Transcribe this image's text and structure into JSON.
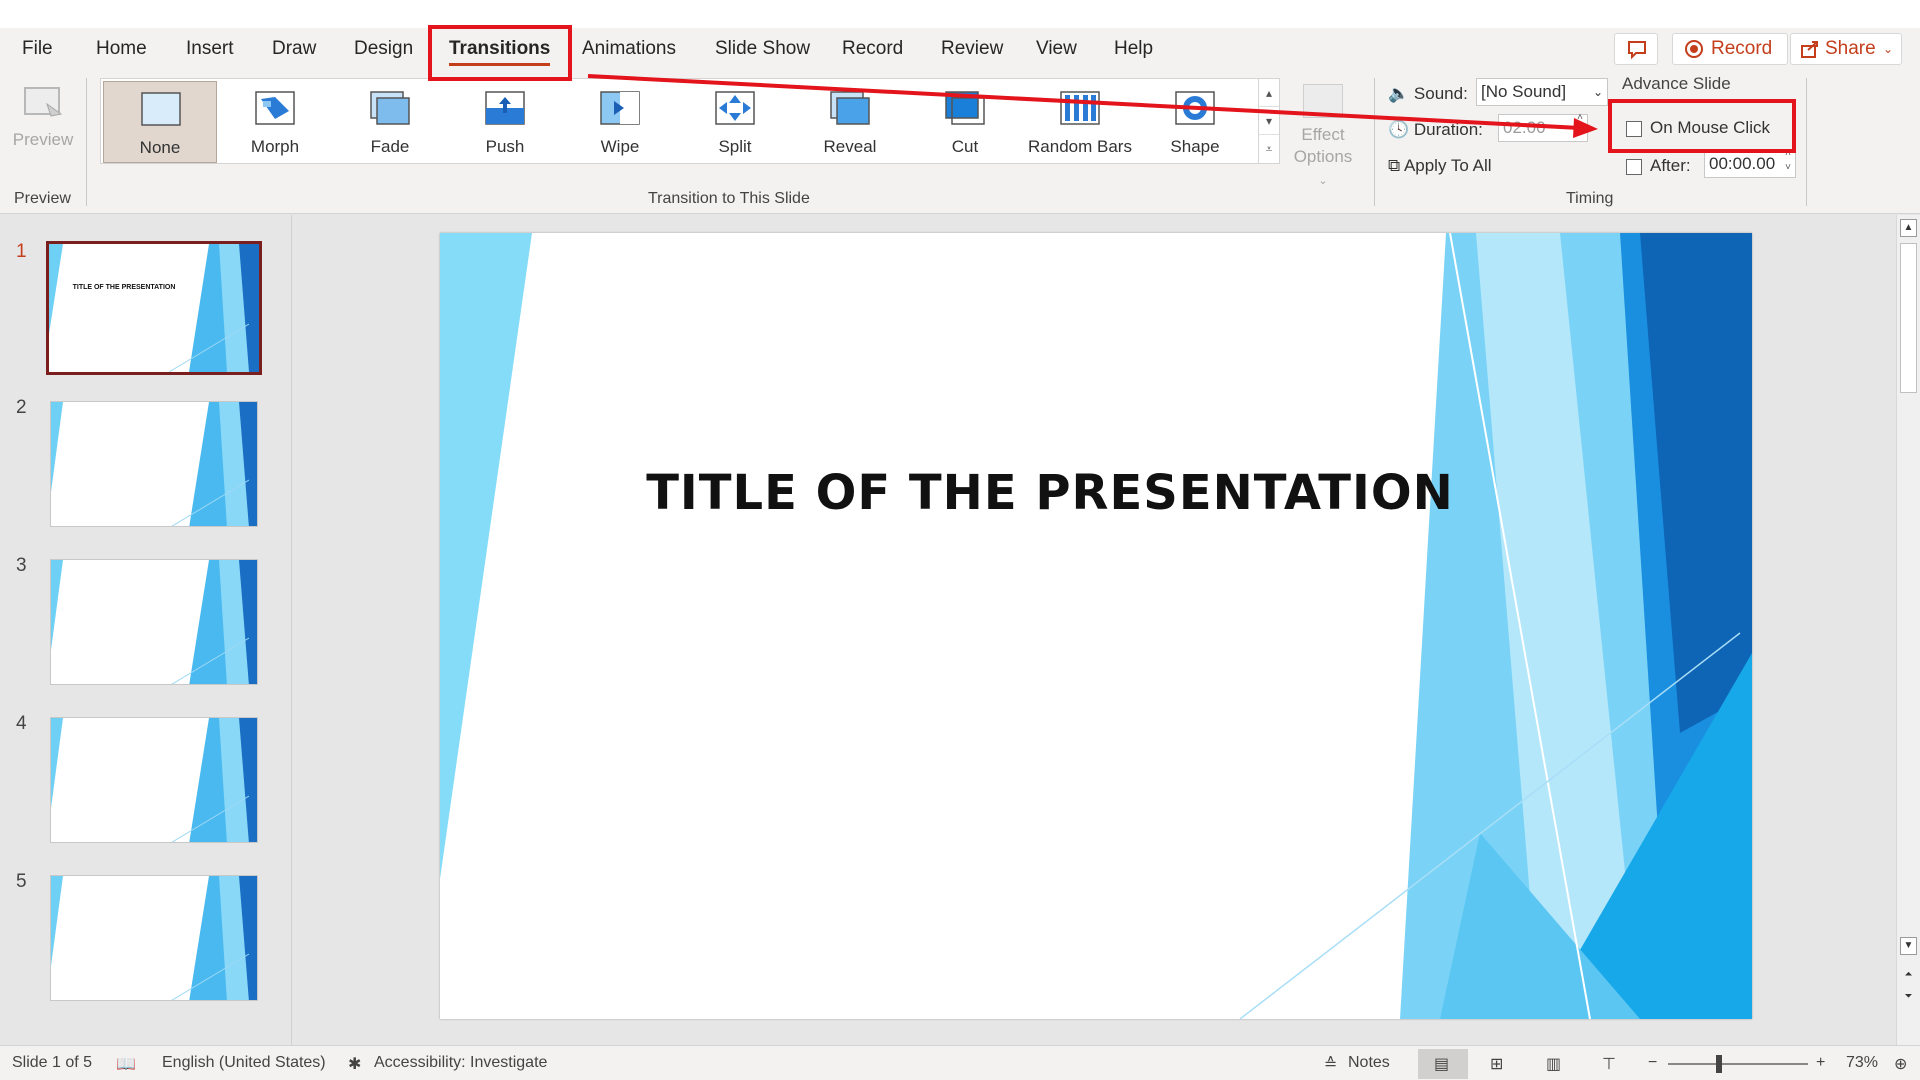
{
  "tabs": [
    {
      "label": "File"
    },
    {
      "label": "Home"
    },
    {
      "label": "Insert"
    },
    {
      "label": "Draw"
    },
    {
      "label": "Design"
    },
    {
      "label": "Transitions"
    },
    {
      "label": "Animations"
    },
    {
      "label": "Slide Show"
    },
    {
      "label": "Record"
    },
    {
      "label": "Review"
    },
    {
      "label": "View"
    },
    {
      "label": "Help"
    }
  ],
  "header": {
    "record_label": "Record",
    "share_label": "Share"
  },
  "preview": {
    "button_label": "Preview",
    "group_label": "Preview"
  },
  "transitions": {
    "group_label": "Transition to This Slide",
    "items": [
      {
        "label": "None"
      },
      {
        "label": "Morph"
      },
      {
        "label": "Fade"
      },
      {
        "label": "Push"
      },
      {
        "label": "Wipe"
      },
      {
        "label": "Split"
      },
      {
        "label": "Reveal"
      },
      {
        "label": "Cut"
      },
      {
        "label": "Random Bars"
      },
      {
        "label": "Shape"
      }
    ],
    "effect_options_line1": "Effect",
    "effect_options_line2": "Options"
  },
  "timing": {
    "group_label": "Timing",
    "sound_label": "Sound:",
    "sound_value": "[No Sound]",
    "duration_label": "Duration:",
    "duration_value": "02.00",
    "apply_all_label": "Apply To All",
    "advance_slide_label": "Advance Slide",
    "on_mouse_click_label": "On Mouse Click",
    "after_label": "After:",
    "after_value": "00:00.00"
  },
  "slides": [
    {
      "number": "1",
      "title": "TITLE OF THE PRESENTATION"
    },
    {
      "number": "2"
    },
    {
      "number": "3"
    },
    {
      "number": "4"
    },
    {
      "number": "5"
    }
  ],
  "slide_main": {
    "title": "TITLE OF THE PRESENTATION"
  },
  "status": {
    "slide_indicator": "Slide 1 of 5",
    "language": "English (United States)",
    "accessibility": "Accessibility: Investigate",
    "notes_label": "Notes",
    "zoom": "73%"
  },
  "colors": {
    "accent": "#c43e1c",
    "highlight": "#e3141b",
    "slide_blue": "#1aa3e8"
  }
}
